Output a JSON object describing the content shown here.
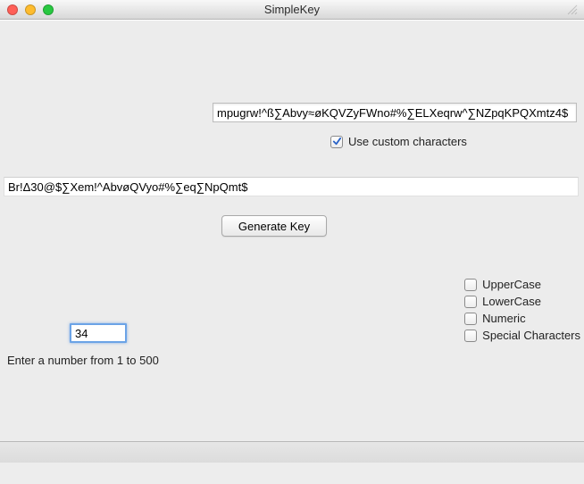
{
  "window": {
    "title": "SimpleKey"
  },
  "custom_chars": {
    "value": "mpugrw!^ß∑Abvy≈øKQVZyFWno#%∑ELXeqrw^∑NZpqKPQXmtz4$",
    "checkbox_label": "Use custom characters",
    "checked": true
  },
  "output": {
    "value": "Br!Δ30@$∑Xem!^AbvøQVyo#%∑eq∑NpQmt$"
  },
  "generate": {
    "label": "Generate Key"
  },
  "options": {
    "uppercase": {
      "label": "UpperCase",
      "checked": false
    },
    "lowercase": {
      "label": "LowerCase",
      "checked": false
    },
    "numeric": {
      "label": "Numeric",
      "checked": false
    },
    "special": {
      "label": "Special Characters",
      "checked": false
    }
  },
  "number": {
    "value": "34",
    "helper": "Enter a number from 1 to 500"
  }
}
